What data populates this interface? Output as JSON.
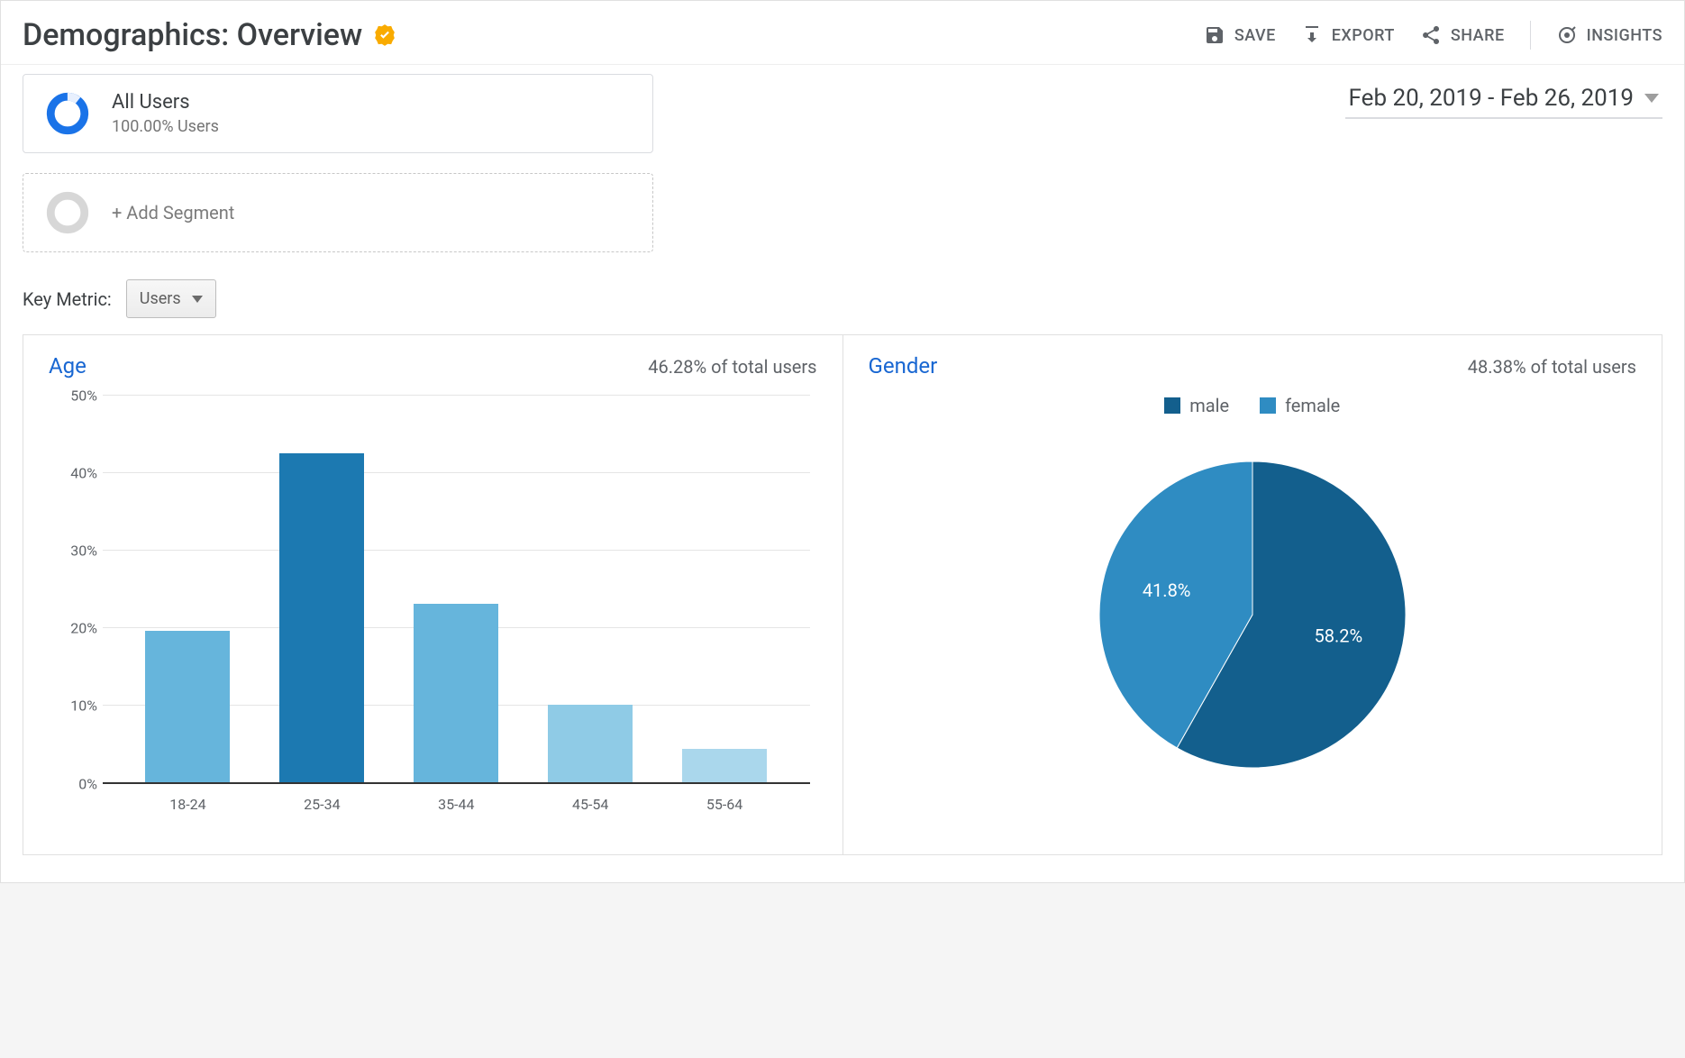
{
  "header": {
    "title": "Demographics: Overview",
    "actions": {
      "save": "SAVE",
      "export": "EXPORT",
      "share": "SHARE",
      "insights": "INSIGHTS"
    }
  },
  "segment": {
    "title": "All Users",
    "subtitle": "100.00% Users",
    "add_label": "+ Add Segment"
  },
  "date_range": "Feb 20, 2019 - Feb 26, 2019",
  "key_metric": {
    "label": "Key Metric:",
    "selected": "Users"
  },
  "panels": {
    "age": {
      "title": "Age",
      "stat": "46.28% of total users"
    },
    "gender": {
      "title": "Gender",
      "stat": "48.38% of total users",
      "legend": {
        "male": "male",
        "female": "female"
      }
    }
  },
  "colors": {
    "bar_light": "#66b5dc",
    "bar_lighter": "#8fcbe6",
    "bar_lightest": "#aad7ec",
    "bar_dark": "#1c79b1",
    "pie_male": "#135f8d",
    "pie_female": "#2f8cc2"
  },
  "chart_data": [
    {
      "type": "bar",
      "title": "Age",
      "categories": [
        "18-24",
        "25-34",
        "35-44",
        "45-54",
        "55-64"
      ],
      "values": [
        19.5,
        42.5,
        23,
        10,
        4.3
      ],
      "ylabel": "%",
      "ylim": [
        0,
        50
      ],
      "yticks": [
        0,
        10,
        20,
        30,
        40,
        50
      ],
      "bar_colors": [
        "#66b5dc",
        "#1c79b1",
        "#66b5dc",
        "#8fcbe6",
        "#aad7ec"
      ]
    },
    {
      "type": "pie",
      "title": "Gender",
      "series": [
        {
          "name": "male",
          "value": 58.2,
          "color": "#135f8d",
          "label": "58.2%"
        },
        {
          "name": "female",
          "value": 41.8,
          "color": "#2f8cc2",
          "label": "41.8%"
        }
      ]
    }
  ]
}
